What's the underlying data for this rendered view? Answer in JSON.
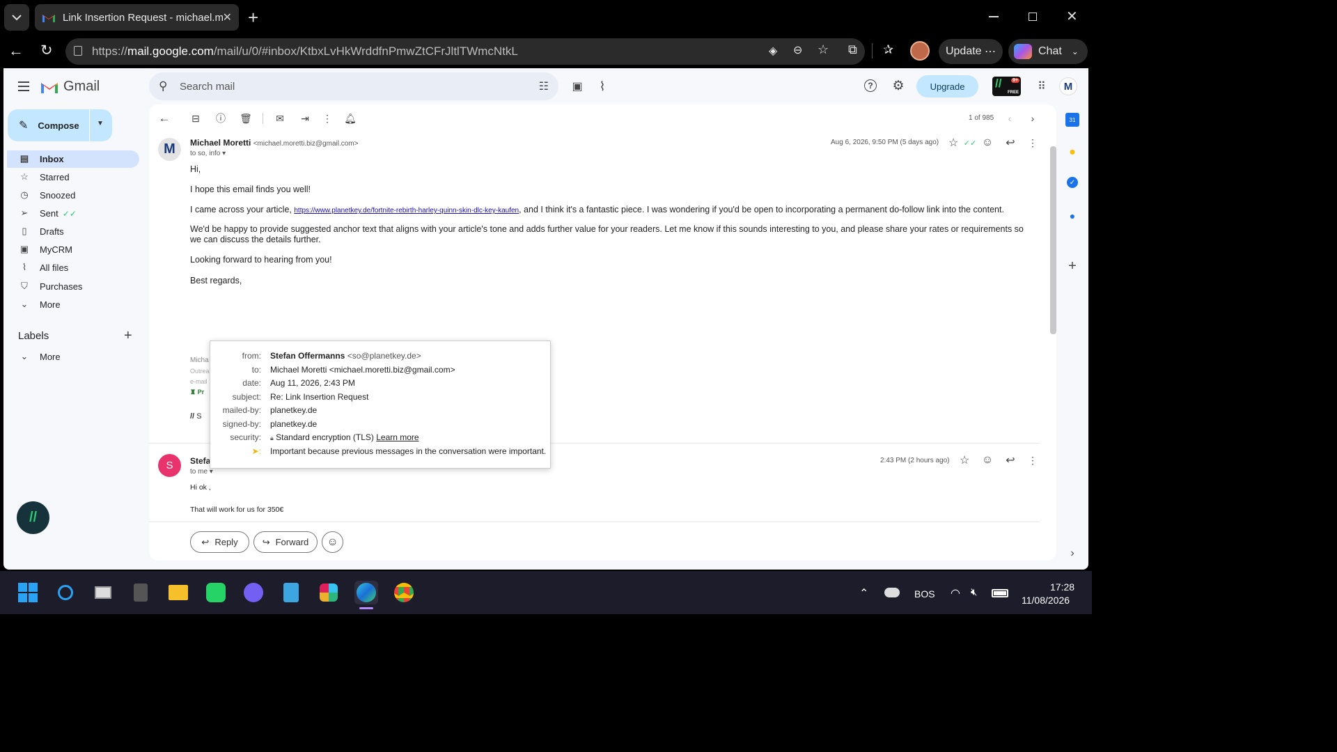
{
  "browser": {
    "tab_title": "Link Insertion Request - michael.m",
    "url_prefix": "https://",
    "url_domain": "mail.google.com",
    "url_path": "/mail/u/0/#inbox/KtbxLvHkWrddfnPmwZtCFrJltlTWmcNtkL",
    "update_label": "Update",
    "chat_label": "Chat"
  },
  "gmail": {
    "logo_text": "Gmail",
    "search_placeholder": "Search mail",
    "upgrade_label": "Upgrade",
    "avatar_letter": "M",
    "badge_count": "9+",
    "badge_free": "FREE"
  },
  "sidebar": {
    "compose": "Compose",
    "items": [
      {
        "label": "Inbox"
      },
      {
        "label": "Starred"
      },
      {
        "label": "Snoozed"
      },
      {
        "label": "Sent"
      },
      {
        "label": "Drafts"
      },
      {
        "label": "MyCRM"
      },
      {
        "label": "All files"
      },
      {
        "label": "Purchases"
      },
      {
        "label": "More"
      }
    ],
    "labels_title": "Labels",
    "labels_more": "More"
  },
  "toolbar": {
    "counter": "1 of 985"
  },
  "message1": {
    "avatar": "M",
    "sender": "Michael Moretti",
    "email": "<michael.moretti.biz@gmail.com>",
    "to": "to so, info",
    "date": "Aug 6, 2026, 9:50 PM (5 days ago)",
    "greeting": "Hi,",
    "p1": "I hope this email finds you well!",
    "p2_before": "I came across your article, ",
    "p2_link": "https://www.planetkey.de/fortnite-rebirth-harley-quinn-skin-dlc-key-kaufen",
    "p2_after": ", and I think it's a fantastic piece. I was wondering if you'd be open to incorporating a permanent do-follow link into the content.",
    "p3": "We'd be happy to provide suggested anchor text that aligns with your article's tone and adds further value for your readers. Let me know if this sounds interesting to you, and please share your rates or requirements so we can discuss the details further.",
    "p4": "Looking forward to hearing from you!",
    "p5": "Best regards,",
    "sig1": "Micha",
    "sig2": "Outrea",
    "sig3": "e-mail",
    "sig4": "Pr",
    "sig5": "S"
  },
  "popup": {
    "from_k": "from:",
    "from_name": "Stefan Offermanns",
    "from_email": "<so@planetkey.de>",
    "to_k": "to:",
    "to_v": "Michael Moretti <michael.moretti.biz@gmail.com>",
    "date_k": "date:",
    "date_v": "Aug 11, 2026, 2:43 PM",
    "subject_k": "subject:",
    "subject_v": "Re: Link Insertion Request",
    "mailed_k": "mailed-by:",
    "mailed_v": "planetkey.de",
    "signed_k": "signed-by:",
    "signed_v": "planetkey.de",
    "security_k": "security:",
    "security_v": "Standard encryption (TLS)",
    "learn_more": "Learn more",
    "important_v": "Important because previous messages in the conversation were important."
  },
  "message2": {
    "avatar": "S",
    "sender": "Stefa",
    "to": "to me",
    "date": "2:43 PM (2 hours ago)",
    "line1": "Hi ok ,",
    "line2": "That will work for us for 350€"
  },
  "actions": {
    "reply": "Reply",
    "forward": "Forward"
  },
  "taskbar": {
    "lang": "BOS",
    "time": "17:28",
    "date": "11/08/2026"
  },
  "colors": {
    "gmail_red": "#ea4335",
    "compose_bg": "#c2e7ff",
    "active_bg": "#d3e3fd",
    "link": "#1a0dab"
  }
}
